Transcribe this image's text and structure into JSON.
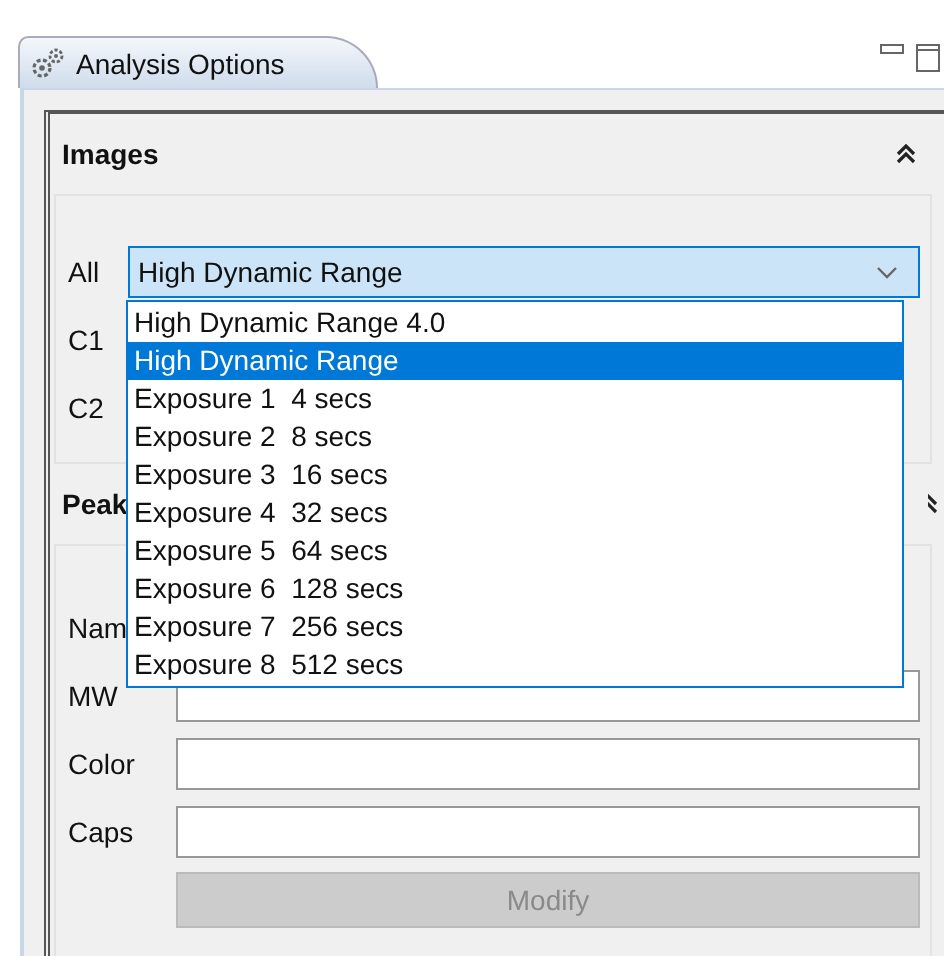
{
  "tab": {
    "title": "Analysis Options",
    "selected": true
  },
  "images": {
    "title": "Images",
    "expanded": true,
    "rows": [
      {
        "label": "All",
        "value": "High Dynamic Range",
        "has_select": true
      },
      {
        "label": "C1",
        "has_select": false
      },
      {
        "label": "C2",
        "has_select": false
      }
    ]
  },
  "dropdown_list": {
    "options": [
      {
        "label": "High Dynamic Range 4.0",
        "selected": false
      },
      {
        "label": "High Dynamic Range",
        "selected": true
      },
      {
        "label": "Exposure 1  4 secs",
        "selected": false
      },
      {
        "label": "Exposure 2  8 secs",
        "selected": false
      },
      {
        "label": "Exposure 3  16 secs",
        "selected": false
      },
      {
        "label": "Exposure 4  32 secs",
        "selected": false
      },
      {
        "label": "Exposure 5  64 secs",
        "selected": false
      },
      {
        "label": "Exposure 6  128 secs",
        "selected": false
      },
      {
        "label": "Exposure 7  256 secs",
        "selected": false
      },
      {
        "label": "Exposure 8  512 secs",
        "selected": false
      }
    ]
  },
  "peaks": {
    "title": "Peak",
    "expanded": true,
    "fields": [
      {
        "label": "Nam",
        "has_input": false
      },
      {
        "label": "MW",
        "has_input": true
      },
      {
        "label": "Color",
        "has_input": true
      },
      {
        "label": "Caps",
        "has_input": true
      }
    ],
    "button": {
      "label": "Modify",
      "disabled": true
    }
  }
}
